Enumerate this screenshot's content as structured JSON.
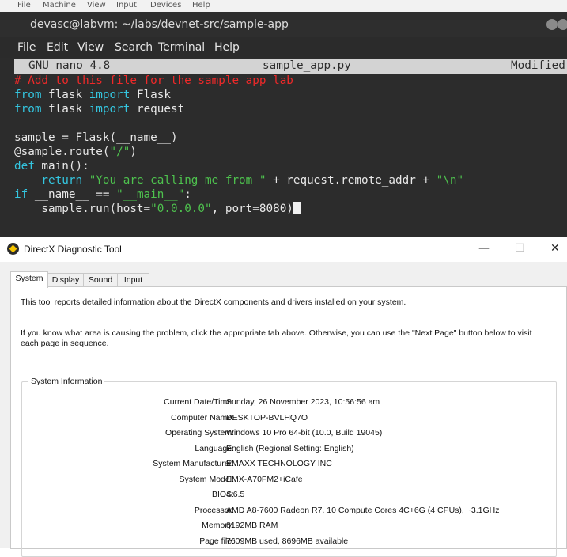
{
  "vm_menu": [
    "File",
    "Machine",
    "View",
    "Input",
    "Devices",
    "Help"
  ],
  "terminal": {
    "title": "devasc@labvm: ~/labs/devnet-src/sample-app",
    "menu": [
      "File",
      "Edit",
      "View",
      "Search",
      "Terminal",
      "Help"
    ],
    "nano": {
      "version": "GNU nano 4.8",
      "filename": "sample_app.py",
      "status": "Modified"
    },
    "code": {
      "l1": "# Add to this file for the sample app lab",
      "l2_kw": "from",
      "l2_rest": " flask ",
      "l2_kw2": "import",
      "l2_end": " Flask",
      "l3_kw": "from",
      "l3_rest": " flask ",
      "l3_kw2": "import",
      "l3_end": " request",
      "l5": "sample = Flask(__name__)",
      "l6_a": "@sample.route(",
      "l6_str": "\"/\"",
      "l6_b": ")",
      "l7_kw": "def",
      "l7_rest": " main():",
      "l8_a": "    return ",
      "l8_str1": "\"You are calling me from \"",
      "l8_b": " + request.remote_addr + ",
      "l8_str2": "\"\\n\"",
      "l9_kw": "if",
      "l9_a": " __name__ == ",
      "l9_str": "\"__main__\"",
      "l9_b": ":",
      "l10_a": "    sample.run(host=",
      "l10_str": "\"0.0.0.0\"",
      "l10_b": ", port=8080)"
    },
    "colors": {
      "comment": "#ef2929",
      "keyword": "#34c6e0",
      "string": "#4ec24e"
    }
  },
  "dxdiag": {
    "title": "DirectX Diagnostic Tool",
    "controls": {
      "minimize": "—",
      "maximize": "☐",
      "close": "✕"
    },
    "tabs": [
      "System",
      "Display",
      "Sound",
      "Input"
    ],
    "active_tab": "System",
    "intro1": "This tool reports detailed information about the DirectX components and drivers installed on your system.",
    "intro2": "If you know what area is causing the problem, click the appropriate tab above.  Otherwise, you can use the \"Next Page\" button below to visit each page in sequence.",
    "section_title": "System Information",
    "info": [
      {
        "label": "Current Date/Time:",
        "value": "Sunday, 26 November 2023, 10:56:56 am"
      },
      {
        "label": "Computer Name:",
        "value": "DESKTOP-BVLHQ7O"
      },
      {
        "label": "Operating System:",
        "value": "Windows 10 Pro 64-bit (10.0, Build 19045)"
      },
      {
        "label": "Language:",
        "value": "English (Regional Setting: English)"
      },
      {
        "label": "System Manufacturer:",
        "value": "EMAXX TECHNOLOGY INC"
      },
      {
        "label": "System Model:",
        "value": "EMX-A70FM2+iCafe"
      },
      {
        "label": "BIOS:",
        "value": "4.6.5"
      },
      {
        "label": "Processor:",
        "value": "AMD A8-7600 Radeon R7, 10 Compute Cores 4C+6G   (4 CPUs), ~3.1GHz"
      },
      {
        "label": "Memory:",
        "value": "8192MB RAM"
      },
      {
        "label": "Page file:",
        "value": "7609MB used, 8696MB available"
      }
    ]
  }
}
